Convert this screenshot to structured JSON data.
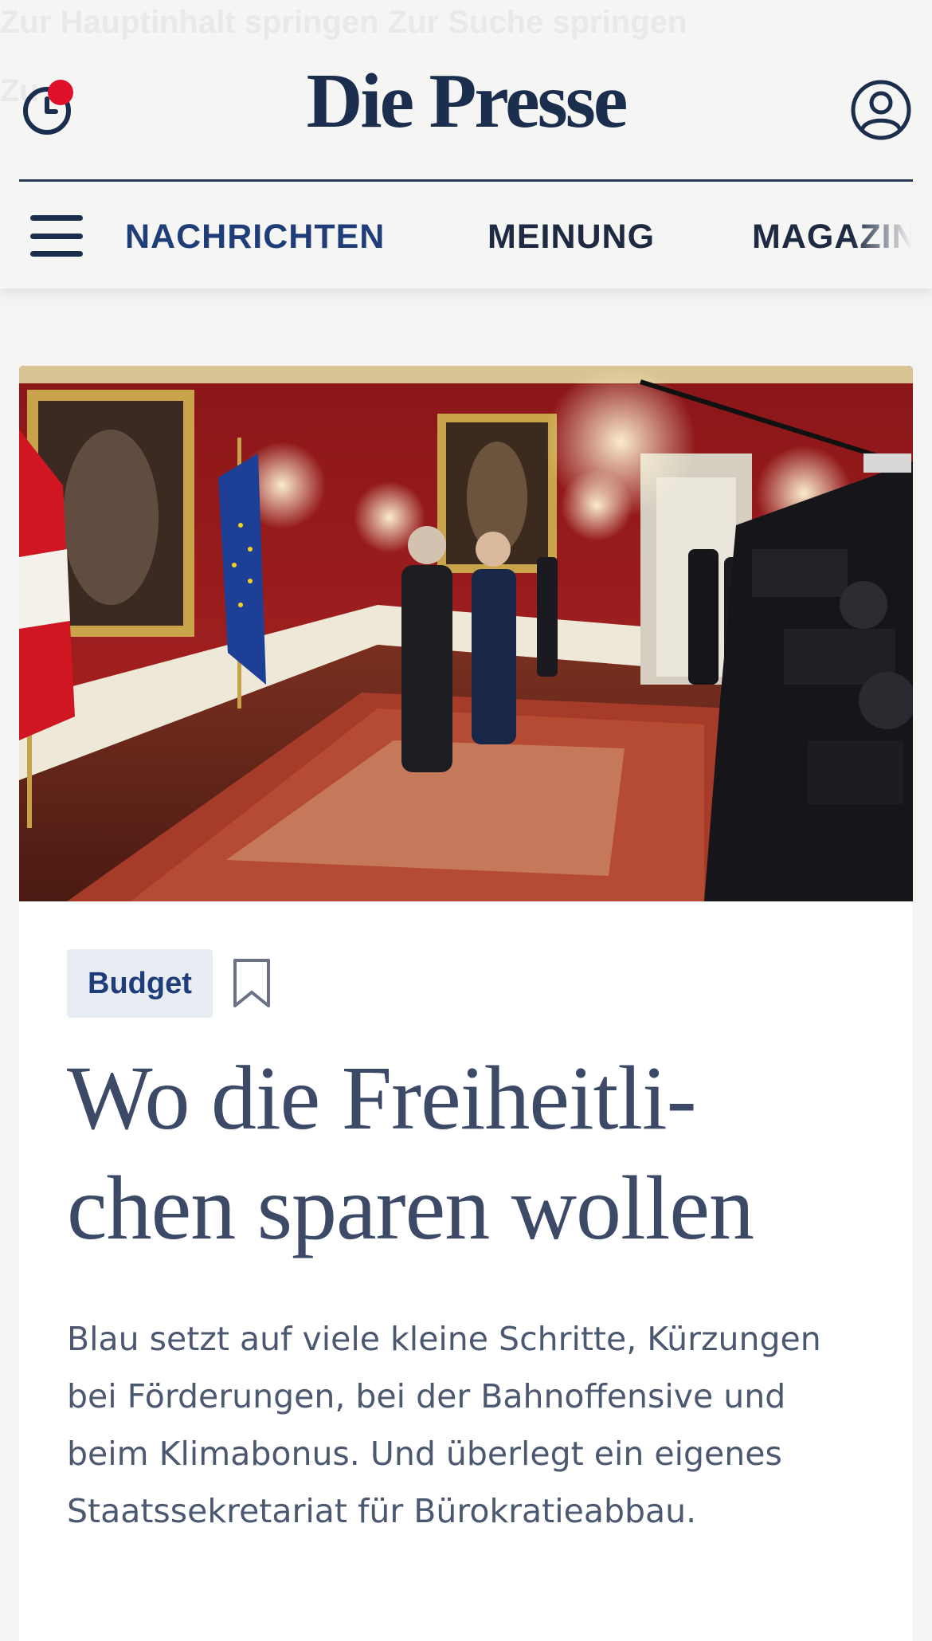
{
  "header": {
    "ghost_line_1": "Zur Hauptinhalt springen     Zur Suche springen",
    "ghost_line_2": "Zu",
    "logo": "Die Presse",
    "history_icon": "clock-history-icon",
    "notification_dot_color": "#e0102b",
    "account_icon": "user-account-icon",
    "menu_icon": "hamburger-menu-icon"
  },
  "nav": {
    "items": [
      {
        "label": "NACHRICHTEN",
        "active": true
      },
      {
        "label": "MEINUNG",
        "active": false
      },
      {
        "label": "MAGAZIN",
        "active": false
      }
    ]
  },
  "article": {
    "category": "Budget",
    "bookmark_icon": "bookmark-icon",
    "headline_line_1": "Wo die Freiheitli-",
    "headline_line_2": "chen sparen wollen",
    "lead": "Blau setzt auf viele kleine Schritte, Kürzungen bei Förderungen, bei der Bahnoffensive und beim Klimabonus. Und überlegt ein eigenes Staatssekretariat für Bürokratieabbau."
  },
  "colors": {
    "brand_navy": "#1c2e4e",
    "nav_active": "#1f3d78",
    "tag_background": "#e8edf3",
    "headline": "#3c4a68"
  }
}
